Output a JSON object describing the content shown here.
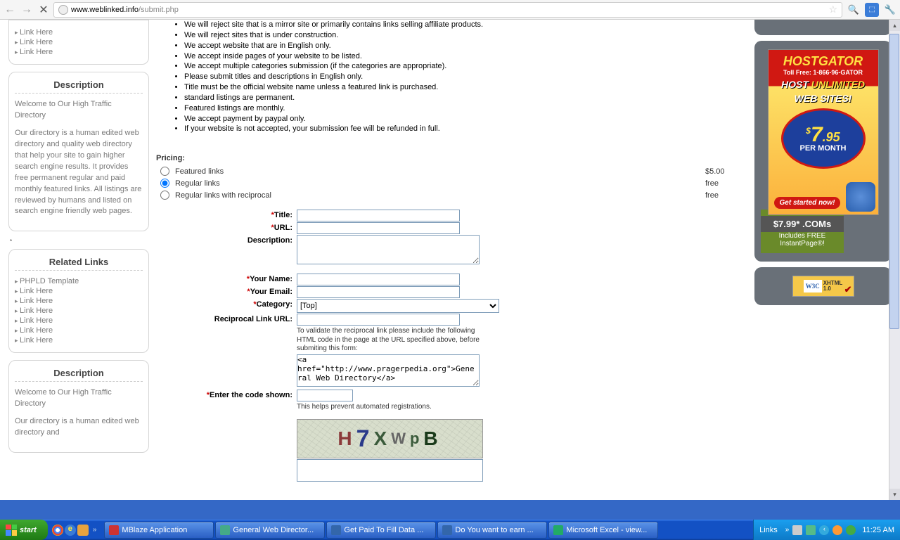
{
  "browser": {
    "url_domain": "www.weblinked.info",
    "url_path": "/submit.php"
  },
  "sidebar": {
    "links_top": [
      "Link Here",
      "Link Here",
      "Link Here"
    ],
    "desc_title": "Description",
    "desc_heading": "Welcome to Our High Traffic Directory",
    "desc_body": "Our directory is a human edited web directory and quality web directory that help your site to gain higher search engine results. It provides free permanent regular and paid monthly featured links. All listings are reviewed by humans and listed on search engine friendly web pages.",
    "related_title": "Related Links",
    "related_links": [
      "PHPLD Template",
      "Link Here",
      "Link Here",
      "Link Here",
      "Link Here",
      "Link Here",
      "Link Here"
    ],
    "desc2_title": "Description",
    "desc2_heading": "Welcome to Our High Traffic Directory",
    "desc2_body_partial": "Our directory is a human edited web directory and"
  },
  "rules": [
    "We will reject site that is a mirror site or primarily contains links selling affiliate products.",
    "We will reject sites that is under construction.",
    "We accept website that are in English only.",
    "We accept inside pages of your website to be listed.",
    "We accept multiple categories submission (if the categories are appropriate).",
    "Please submit titles and descriptions in English only.",
    "Title must be the official website name unless a featured link is purchased.",
    "standard listings are permanent.",
    "Featured listings are monthly.",
    "We accept payment by paypal only.",
    "If your website is not accepted, your submission fee will be refunded in full."
  ],
  "pricing": {
    "heading": "Pricing:",
    "options": [
      {
        "label": "Featured links",
        "price": "$5.00",
        "checked": false
      },
      {
        "label": "Regular links",
        "price": "free",
        "checked": true
      },
      {
        "label": "Regular links with reciprocal",
        "price": "free",
        "checked": false
      }
    ]
  },
  "form": {
    "title_label": "Title:",
    "url_label": "URL:",
    "description_label": "Description:",
    "name_label": "Your Name:",
    "email_label": "Your Email:",
    "category_label": "Category:",
    "category_value": "[Top]",
    "reciprocal_label": "Reciprocal Link URL:",
    "reciprocal_help": "To validate the reciprocal link please include the following HTML code in the page at the URL specified above, before submiting this form:",
    "reciprocal_code": "<a href=\"http://www.pragerpedia.org\">General Web Directory</a>",
    "code_label": "Enter the code shown:",
    "code_help": "This helps prevent automated registrations.",
    "captcha_chars": [
      "H",
      "7",
      "X",
      "W",
      "p",
      "B"
    ]
  },
  "ads": {
    "hostgator": {
      "title": "HOSTGATOR",
      "toll": "Toll Free: 1-866-96-GATOR",
      "line1": "HOST",
      "line1b": "UNLIMITED",
      "line2": "WEB SITES!",
      "price": "7",
      "cents": ".95",
      "per": "PER MONTH",
      "cta": "Get started now!"
    },
    "godaddy": {
      "top": "$7.99* .COMs",
      "mid": "Includes FREE",
      "bot": "InstantPage®!"
    },
    "xhtml": {
      "w3c": "W3C",
      "label": "XHTML\n1.0"
    }
  },
  "taskbar": {
    "start": "start",
    "tasks": [
      {
        "label": "MBlaze Application",
        "color": "#c33"
      },
      {
        "label": "General Web Director...",
        "color": "#4a8"
      },
      {
        "label": "Get Paid To Fill Data ...",
        "color": "#36a"
      },
      {
        "label": "Do You want to earn ...",
        "color": "#36a"
      },
      {
        "label": "Microsoft Excel - view...",
        "color": "#2a6"
      }
    ],
    "links_label": "Links",
    "clock": "11:25 AM"
  }
}
